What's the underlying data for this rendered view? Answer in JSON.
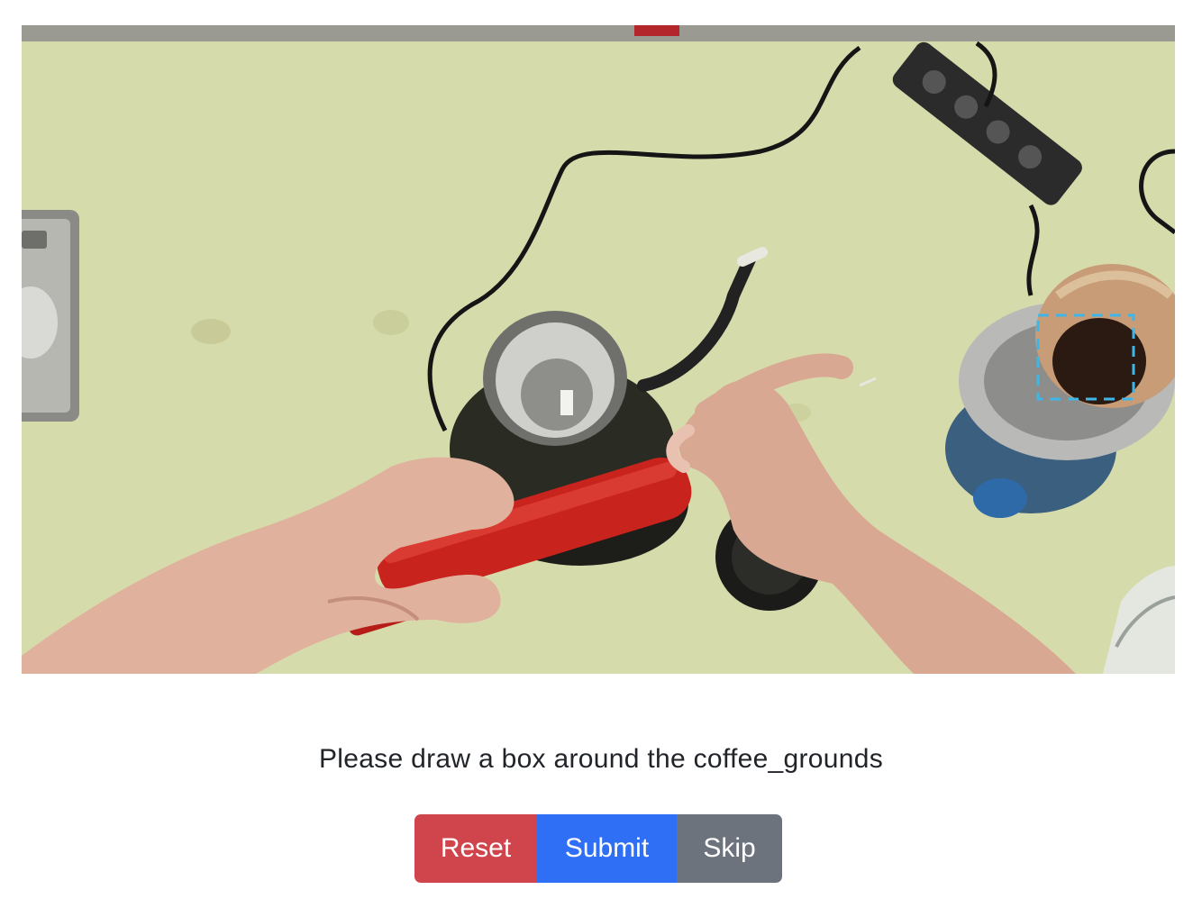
{
  "prompt": {
    "text": "Please draw a box around the coffee_grounds"
  },
  "buttons": {
    "reset_label": "Reset",
    "submit_label": "Submit",
    "skip_label": "Skip"
  },
  "colors": {
    "reset": "#d0444b",
    "submit": "#2f6ff5",
    "skip": "#6c737c",
    "selection_box": "#3fb6e8"
  }
}
